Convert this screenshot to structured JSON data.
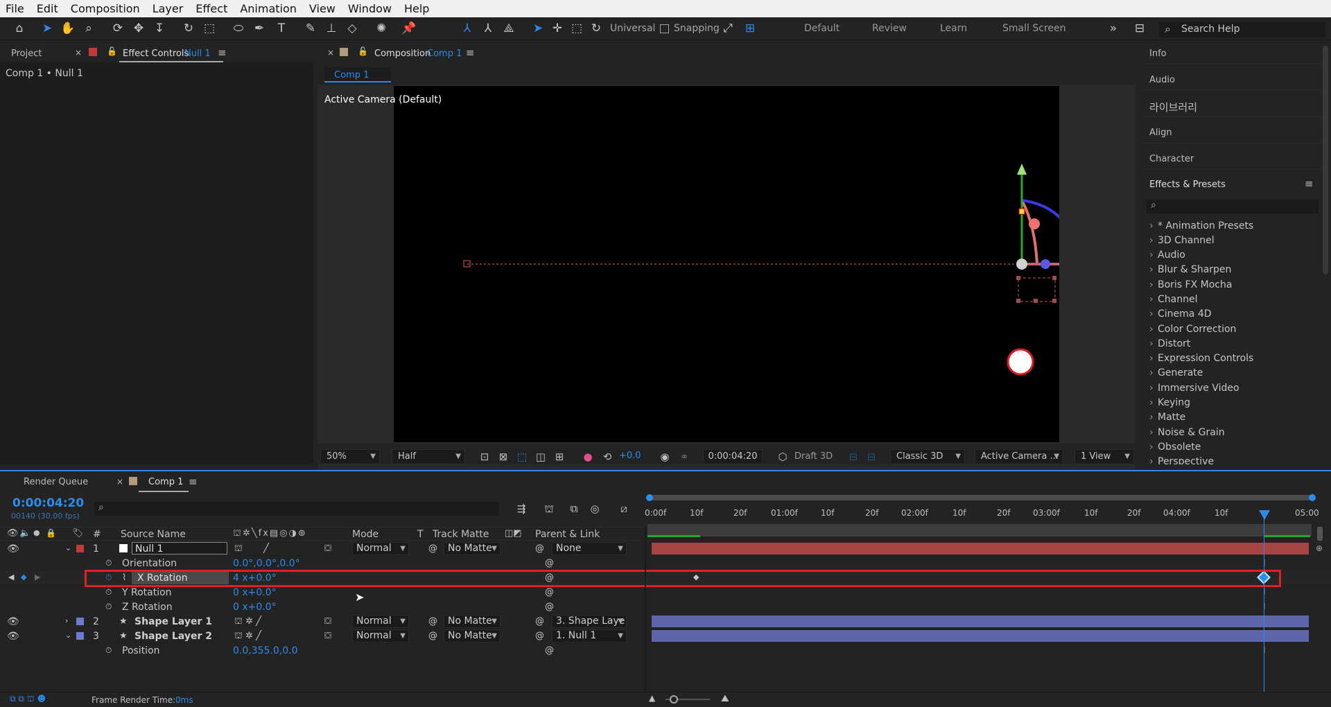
{
  "menu": [
    "File",
    "Edit",
    "Composition",
    "Layer",
    "Effect",
    "Animation",
    "View",
    "Window",
    "Help"
  ],
  "toolbar": {
    "universal_label": "Universal",
    "snapping_label": "Snapping",
    "workspaces": [
      "Default",
      "Review",
      "Learn",
      "Small Screen"
    ],
    "search_help": "Search Help"
  },
  "left_panel": {
    "tab_project": "Project",
    "tab_effect_controls": "Effect Controls",
    "tab_effect_controls_target": "Null 1",
    "breadcrumb": "Comp 1 • Null 1"
  },
  "comp_panel": {
    "tab_label": "Composition",
    "tab_comp_name": "Comp 1",
    "sub_tab": "Comp 1",
    "camera_label": "Active Camera (Default)",
    "zoom": "50%",
    "resolution": "Half",
    "exposure": "+0.0",
    "timecode": "0:00:04:20",
    "renderer": "Draft 3D",
    "renderer_mode": "Classic 3D",
    "camera_view": "Active Camera ...",
    "views": "1 View"
  },
  "right_panel": {
    "items": [
      "Info",
      "Audio",
      "라이브러리",
      "Align",
      "Character"
    ],
    "effects_title": "Effects & Presets",
    "effects": [
      "* Animation Presets",
      "3D Channel",
      "Audio",
      "Blur & Sharpen",
      "Boris FX Mocha",
      "Channel",
      "Cinema 4D",
      "Color Correction",
      "Distort",
      "Expression Controls",
      "Generate",
      "Immersive Video",
      "Keying",
      "Matte",
      "Noise & Grain",
      "Obsolete",
      "Perspective"
    ]
  },
  "timeline": {
    "tab_render_queue": "Render Queue",
    "tab_comp": "Comp 1",
    "current_time": "0:00:04:20",
    "frame_info": "00140 (30.00 fps)",
    "columns": {
      "num": "#",
      "source": "Source Name",
      "mode": "Mode",
      "t": "T",
      "track_matte": "Track Matte",
      "parent": "Parent & Link"
    },
    "ruler_labels": [
      "0:00f",
      "10f",
      "20f",
      "01:00f",
      "10f",
      "20f",
      "02:00f",
      "10f",
      "20f",
      "03:00f",
      "10f",
      "20f",
      "04:00f",
      "10f",
      "05:00"
    ],
    "layers": [
      {
        "num": "1",
        "name": "Null 1",
        "mode": "Normal",
        "matte": "No Matte",
        "parent": "None",
        "color": "#c23b3b"
      },
      {
        "num": "2",
        "name": "Shape Layer 1",
        "mode": "Normal",
        "matte": "No Matte",
        "parent": "3. Shape Laye",
        "color": "#6a7bd1"
      },
      {
        "num": "3",
        "name": "Shape Layer 2",
        "mode": "Normal",
        "matte": "No Matte",
        "parent": "1. Null 1",
        "color": "#6a7bd1"
      }
    ],
    "props": {
      "orientation": {
        "name": "Orientation",
        "value": "0.0°,0.0°,0.0°"
      },
      "x_rotation": {
        "name": "X Rotation",
        "value": "4 x+0.0°"
      },
      "y_rotation": {
        "name": "Y Rotation",
        "value": "0 x+0.0°"
      },
      "z_rotation": {
        "name": "Z Rotation",
        "value": "0 x+0.0°"
      },
      "position": {
        "name": "Position",
        "value": "0.0,355.0,0.0"
      }
    },
    "frame_render_label": "Frame Render Time:",
    "frame_render_value": "0ms"
  },
  "colors": {
    "accent": "#2d8ceb",
    "highlight": "#e31e24",
    "null_bar": "#a84545",
    "shape_bar": "#5c66a8"
  }
}
